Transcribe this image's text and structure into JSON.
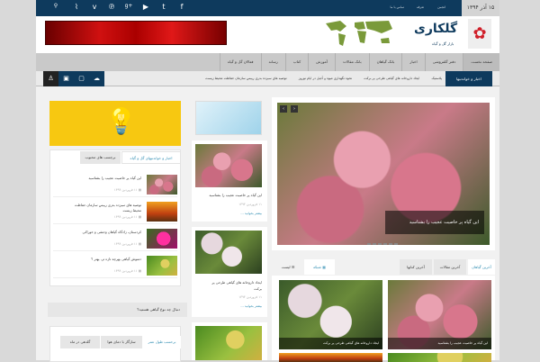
{
  "topbar": {
    "date": "۱۵ آذر ۱۳۹۴",
    "links": [
      "انجمن",
      "تعرفه",
      "تماس با ما"
    ],
    "social": [
      "facebook-icon",
      "twitter-icon",
      "youtube-icon",
      "googleplus-icon",
      "pinterest-icon",
      "vimeo-icon",
      "rss-icon",
      "search-icon"
    ]
  },
  "header": {
    "logo": "گلکاری",
    "logo_sub": "بازار گل و گیاه"
  },
  "nav": [
    "صفحه نخست",
    "دفتر گلفروشی",
    "اخبار",
    "بانک گیاهان",
    "بانک مقالات",
    "آموزش",
    "کتاب",
    "رسانه",
    "فعالان گل و گیاه"
  ],
  "ticker": {
    "label": "اخبار و خواندنیها",
    "items": [
      "پلاستیک",
      "ایجاد داروخانه های گیاهی طرحی پر برکت",
      "نحوه نگهداری میوه و آجیل در ایام نوروز",
      "توصیه های سیزده بدری رییس سازمان حفاظت محیط زیست"
    ]
  },
  "slider": {
    "caption": "این گیاه پر خاصیت عجیب را بشناسید"
  },
  "latest": {
    "tabs": [
      "آخرین گیاهان",
      "آخرین مقالات",
      "آخرین کتابها"
    ],
    "views": [
      "شبکه",
      "لیست"
    ],
    "items": [
      "این گیاه پر خاصیت عجیب را بشناسید",
      "ایجاد داروخانه های گیاهی طرحی پر برکت"
    ]
  },
  "middle": {
    "posts": [
      {
        "title": "این گیاه پر خاصیت عجیب را بشناسید",
        "date": "۱۱ فروردین ۱۳۹۴",
        "more": "بیشتر بخوانید ..."
      },
      {
        "title": "ایجاد داروخانه های گیاهی طرحی پر برکت",
        "date": "۱۱ فروردین ۱۳۹۴",
        "more": "بیشتر بخوانید ..."
      }
    ]
  },
  "sidebar": {
    "tabs": [
      "اخبار و خواندنیهای گل و گیاه",
      "برچسب های محبوب"
    ],
    "items": [
      {
        "title": "این گیاه پر خاصیت عجیب را بشناسید",
        "date": "۱۱ فروردین ۱۳۹۴"
      },
      {
        "title": "توصیه های سیزده بدری رییس سازمان حفاظت محیط زیست",
        "date": "۱۱ فروردین ۱۳۹۴"
      },
      {
        "title": "کردستان، زادگاه گیاهان وحشی و خوراکی",
        "date": "۱۱ فروردین ۱۳۹۴"
      },
      {
        "title": "دمنوش گیاهی بهرچه تازه تر، بهتر ؟",
        "date": "۱۱ فروردین ۱۳۹۴"
      }
    ],
    "question": "دنبال چه نوع گیاهی هستید؟",
    "tabs2": [
      "برحسب طول عمر",
      "سازگار با دمای هوا",
      "گلدهی در ماه"
    ]
  }
}
